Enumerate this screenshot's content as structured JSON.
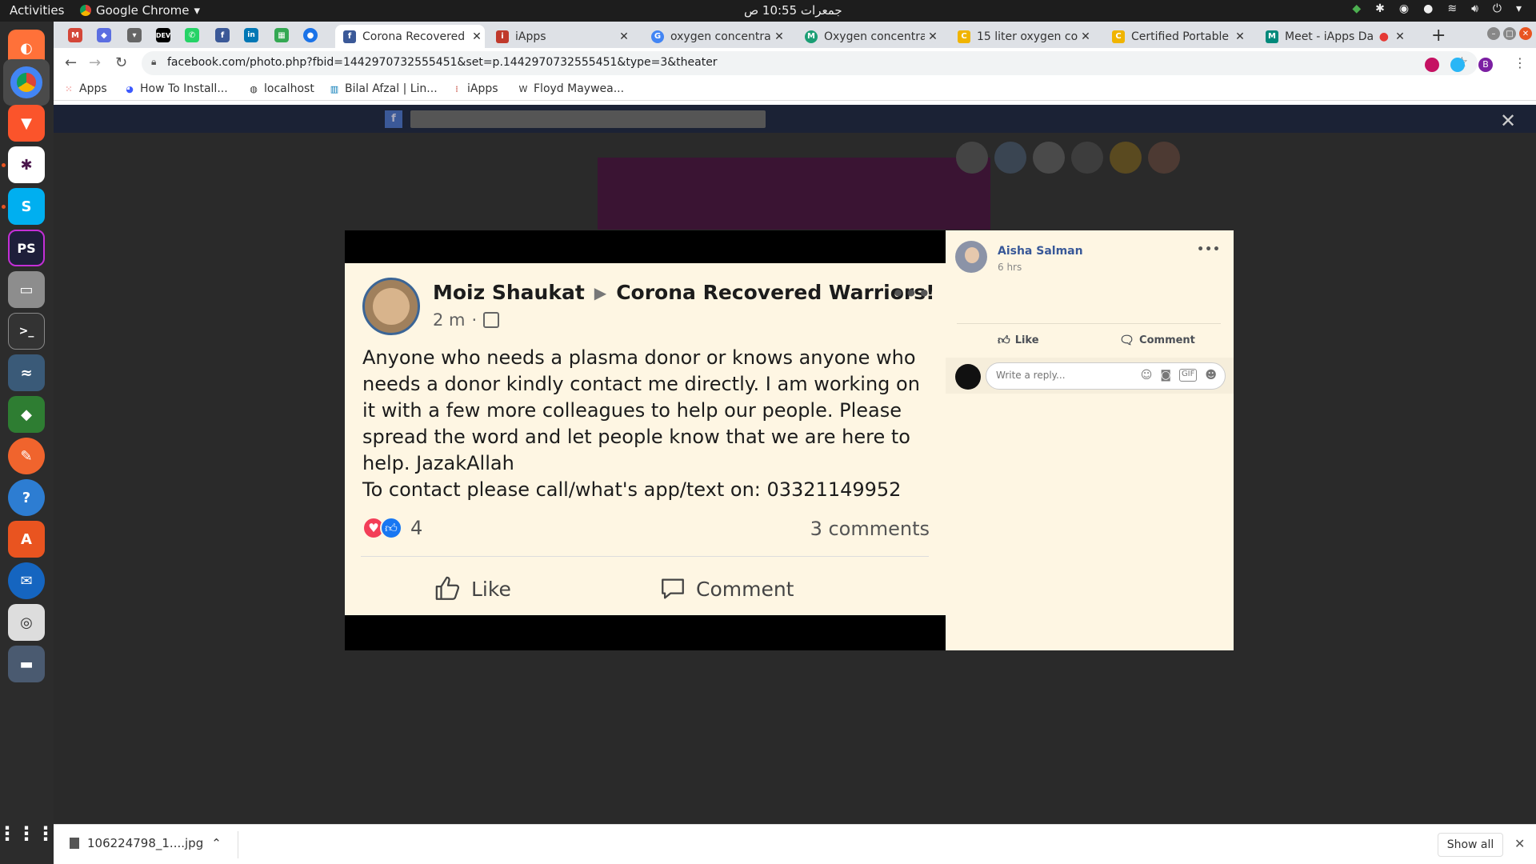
{
  "topbar": {
    "activities": "Activities",
    "app": "Google Chrome",
    "clock": "جمعرات 10:55 ص"
  },
  "tabs": [
    {
      "title": "Corona Recovered",
      "color": "#3b5998",
      "glyph": "f"
    },
    {
      "title": "iApps",
      "color": "#c0392b",
      "glyph": "i"
    },
    {
      "title": "oxygen concentrat",
      "color": "#4285f4",
      "glyph": "G"
    },
    {
      "title": "Oxygen concentrat",
      "color": "#1a9e74",
      "glyph": "M"
    },
    {
      "title": "15 liter oxygen con",
      "color": "#f0b400",
      "glyph": "C"
    },
    {
      "title": "Certified Portable",
      "color": "#f0b400",
      "glyph": "C"
    },
    {
      "title": "Meet - iApps Da",
      "color": "#00897b",
      "glyph": "M"
    }
  ],
  "url": "facebook.com/photo.php?fbid=1442970732555451&set=p.1442970732555451&type=3&theater",
  "bookmarks": [
    "Apps",
    "How To Install...",
    "localhost",
    "Bilal Afzal | Lin...",
    "iApps",
    "Floyd Maywea..."
  ],
  "post": {
    "author": "Moiz Shaukat",
    "group": "Corona Recovered Warriors!",
    "time": "2 m",
    "body": [
      "Anyone who needs a plasma donor or knows anyone who needs a donor kindly contact me directly. I am working on it with a few more colleagues to help our people. Please spread the word and let people know that we are here to help. JazakAllah",
      "To contact please call/what's app/text on: 03321149952"
    ],
    "reaction_count": "4",
    "comments": "3 comments",
    "like": "Like",
    "comment": "Comment"
  },
  "side": {
    "name": "Aisha Salman",
    "time": "6 hrs",
    "like": "Like",
    "comment": "Comment",
    "reply_placeholder": "Write a reply..."
  },
  "shelf": {
    "filename": "106224798_1....jpg",
    "show_all": "Show all"
  },
  "colors": {
    "fb_blue": "#3b5998",
    "post_bg": "#fef6e3",
    "ubuntu_orange": "#e95420"
  }
}
